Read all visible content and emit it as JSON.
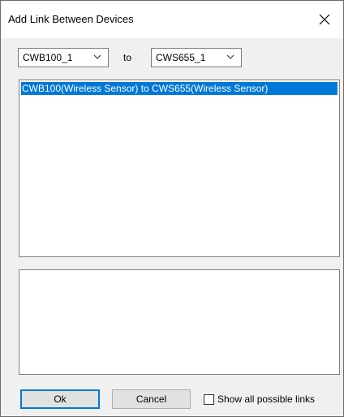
{
  "window": {
    "title": "Add Link Between Devices"
  },
  "selectors": {
    "from_value": "CWB100_1",
    "to_label": "to",
    "to_value": "CWS655_1"
  },
  "links_list": {
    "items": [
      "CWB100(Wireless Sensor) to CWS655(Wireless Sensor)"
    ],
    "selected_index": 0
  },
  "details_text": "",
  "buttons": {
    "ok_label": "Ok",
    "cancel_label": "Cancel"
  },
  "options": {
    "show_all_label": "Show all possible links",
    "show_all_checked": false
  },
  "colors": {
    "selection": "#0078d7",
    "default_button_border": "#0078d7"
  },
  "icons": {
    "close": "close-icon",
    "dropdown": "chevron-down-icon"
  }
}
